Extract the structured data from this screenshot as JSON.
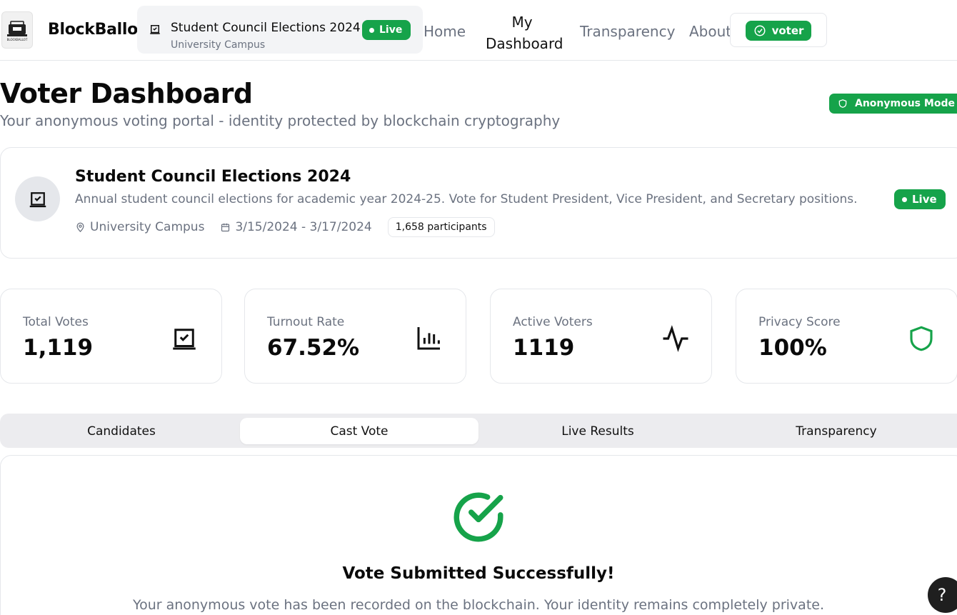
{
  "brand": {
    "name": "BlockBallot",
    "logo_text": "BLOCKBALLOT"
  },
  "nav": {
    "election_title": "Student Council Elections 2024",
    "election_location": "University Campus",
    "live_label": "Live",
    "links": {
      "home": "Home",
      "dashboard": "My Dashboard",
      "transparency": "Transparency",
      "about": "About"
    },
    "role": "voter"
  },
  "header": {
    "title": "Voter Dashboard",
    "subtitle": "Your anonymous voting portal - identity protected by blockchain cryptography",
    "mode_badge": "Anonymous Mode"
  },
  "election": {
    "title": "Student Council Elections 2024",
    "description": "Annual student council elections for academic year 2024-25. Vote for Student President, Vice President, and Secretary positions.",
    "location": "University Campus",
    "dates": "3/15/2024 - 3/17/2024",
    "participants": "1,658 participants",
    "status": "Live"
  },
  "stats": [
    {
      "label": "Total Votes",
      "value": "1,119",
      "icon": "vote-box-icon"
    },
    {
      "label": "Turnout Rate",
      "value": "67.52%",
      "icon": "bar-chart-icon"
    },
    {
      "label": "Active Voters",
      "value": "1119",
      "icon": "activity-icon"
    },
    {
      "label": "Privacy Score",
      "value": "100%",
      "icon": "shield-icon"
    }
  ],
  "tabs": [
    {
      "label": "Candidates"
    },
    {
      "label": "Cast Vote",
      "active": true
    },
    {
      "label": "Live Results"
    },
    {
      "label": "Transparency"
    }
  ],
  "success": {
    "title": "Vote Submitted Successfully!",
    "message": "Your anonymous vote has been recorded on the blockchain. Your identity remains completely private."
  },
  "help": {
    "label": "?"
  },
  "colors": {
    "accent": "#16a34a",
    "muted": "#6b7280",
    "tab_bg": "#ececef",
    "border": "#e5e7eb"
  }
}
